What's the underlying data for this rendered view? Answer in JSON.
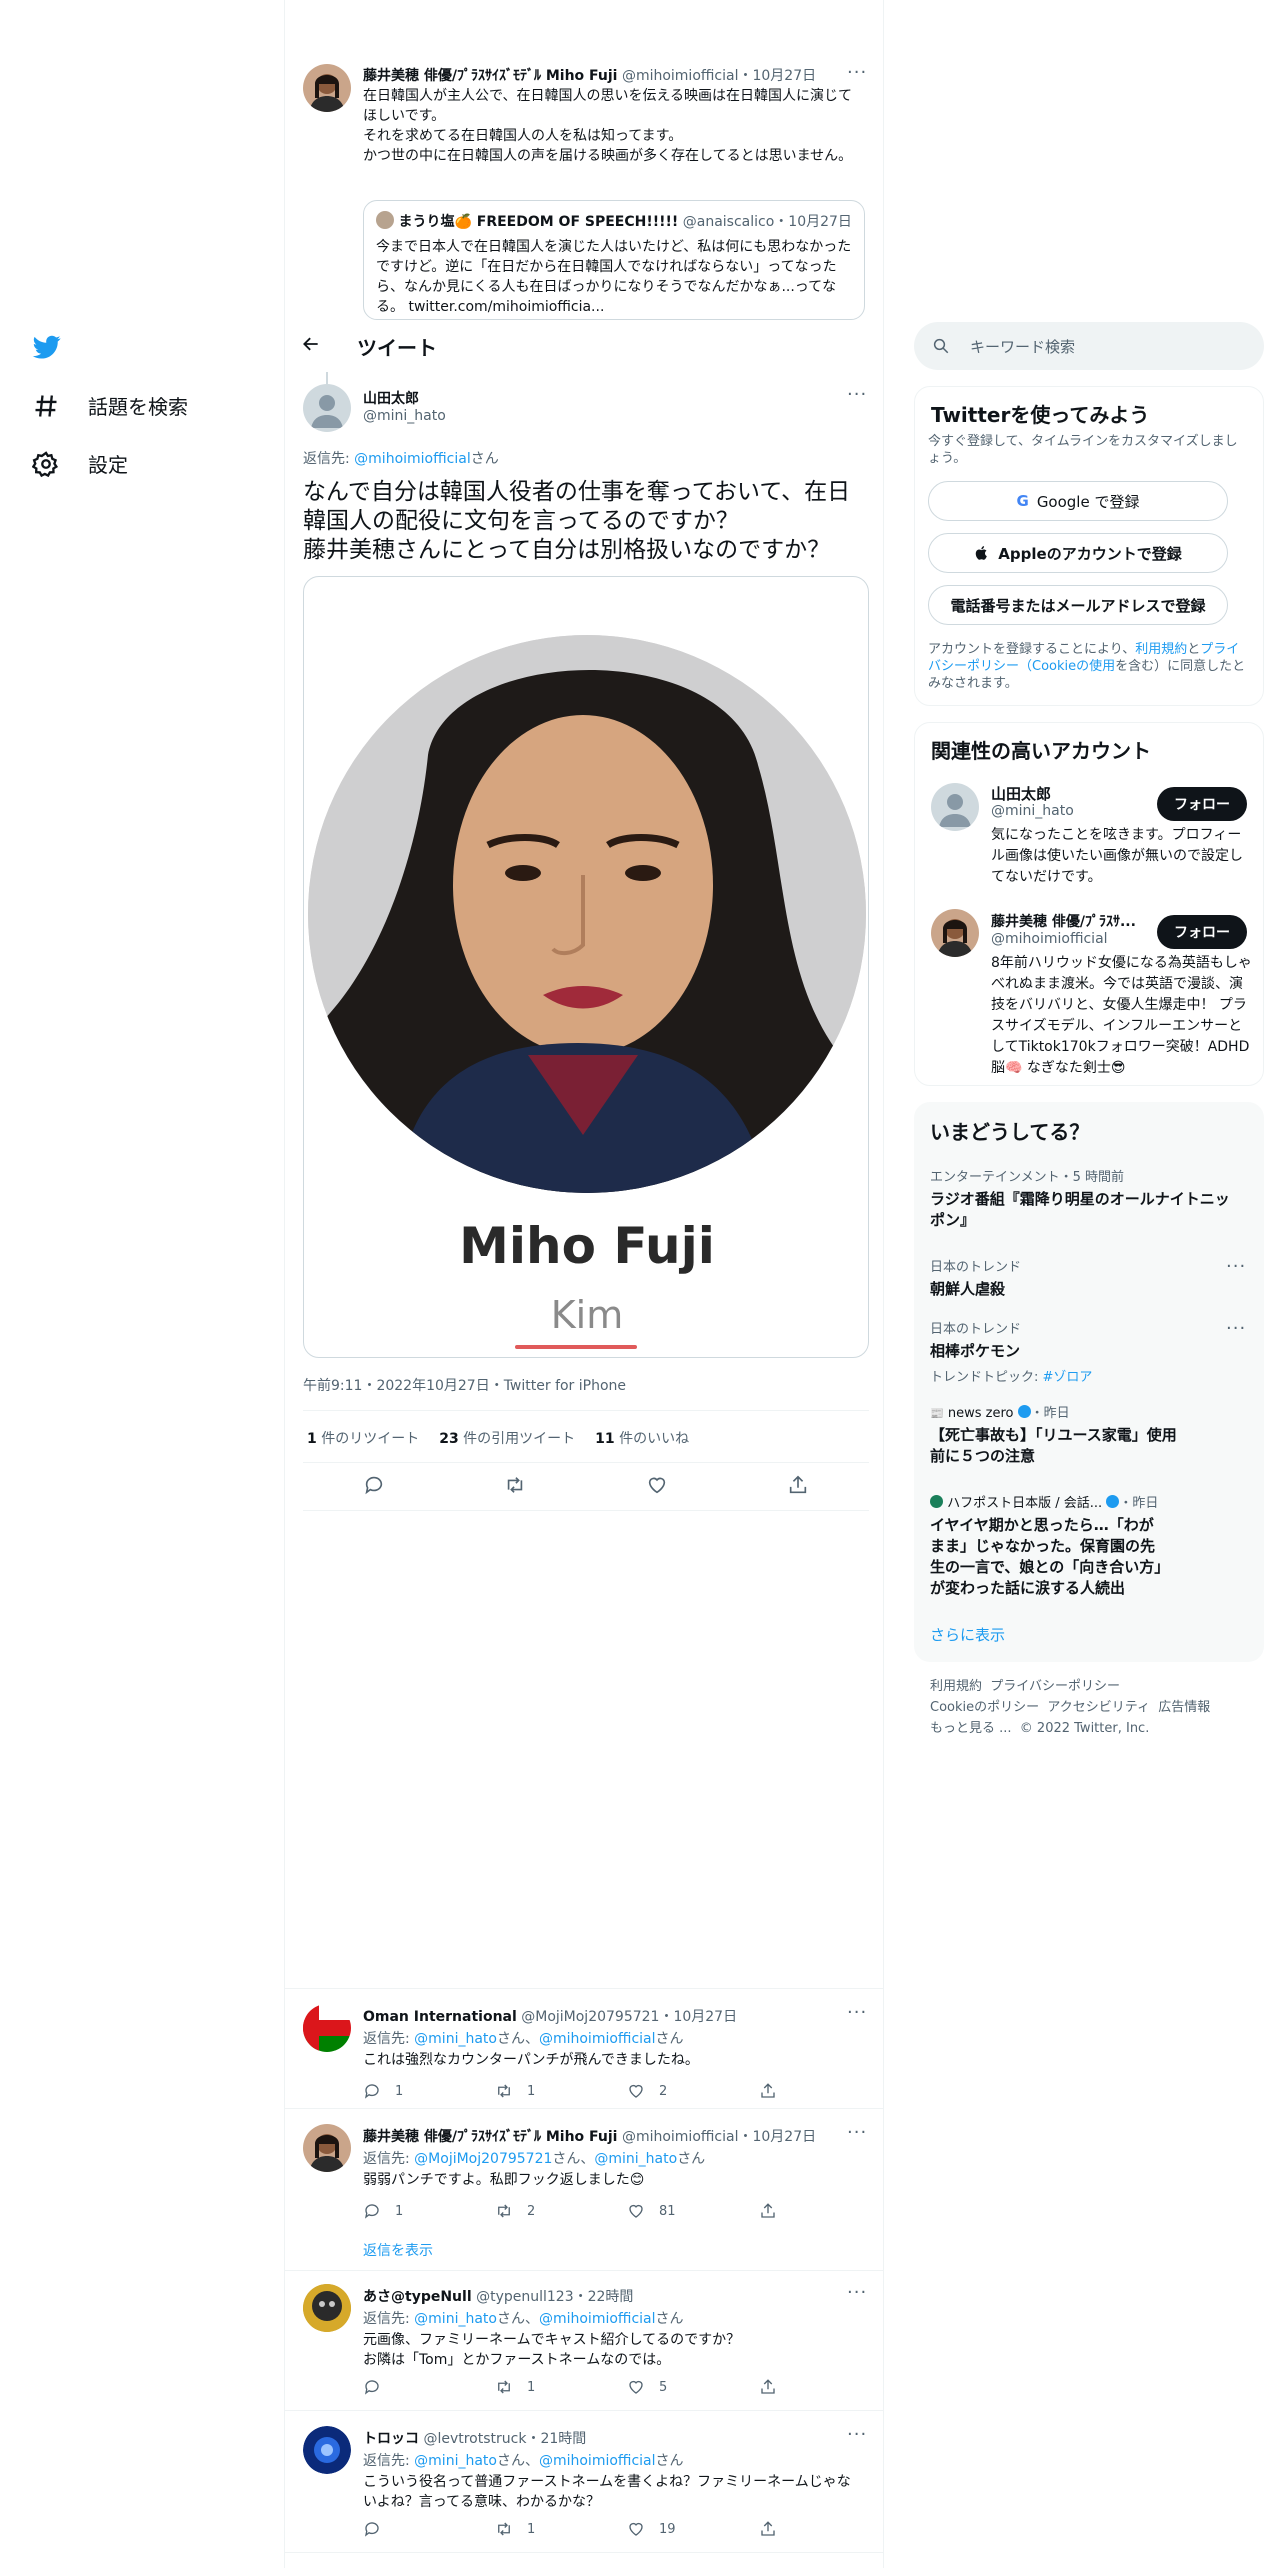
{
  "nav": {
    "items": [
      {
        "label": "話題を検索",
        "icon": "hashtag-icon"
      },
      {
        "label": "設定",
        "icon": "gear-icon"
      }
    ]
  },
  "quoted_tweet": {
    "author_name": "藤井美穂 俳優/ﾌﾟﾗｽｻｲｽﾞﾓﾃﾞﾙ Miho Fuji",
    "handle": "@mihoimiofficial",
    "date": "10月27日",
    "text": "在日韓国人が主人公で、在日韓国人の思いを伝える映画は在日韓国人に演じてほしいです。\nそれを求めてる在日韓国人の人を私は知ってます。\nかつ世の中に在日韓国人の声を届ける映画が多く存在してるとは思いません。",
    "inner": {
      "author_name": "まうり塩🍊 FREEDOM OF SPEECH!!!!!",
      "handle": "@anaiscalico",
      "date": "10月27日",
      "text": "今まで日本人で在日韓国人を演じた人はいたけど、私は何にも思わなかったですけど。逆に「在日だから在日韓国人でなければならない」ってなったら、なんか見にくる人も在日ばっかりになりそうでなんだかなぁ...ってなる。 twitter.com/mihoimiofficia..."
    }
  },
  "header": {
    "title": "ツイート"
  },
  "main_tweet": {
    "author_name": "山田太郎",
    "handle": "@mini_hato",
    "reply_prefix": "返信先: ",
    "reply_to": "@mihoimiofficial",
    "reply_suffix": "さん",
    "text": "なんで自分は韓国人役者の仕事を奪っておいて、在日韓国人の配役に文句を言ってるのですか？\n藤井美穂さんにとって自分は別格扱いなのですか？",
    "image_name": "Miho Fuji",
    "image_sub": "Kim",
    "meta": "午前9:11・2022年10月27日・Twitter for iPhone",
    "stats": [
      {
        "count": "1",
        "label": " 件のリツイート"
      },
      {
        "count": "23",
        "label": " 件の引用ツイート"
      },
      {
        "count": "11",
        "label": " 件のいいね"
      }
    ]
  },
  "replies": [
    {
      "author_name": "Oman International",
      "handle": "@MojiMoj20795721",
      "date": "10月27日",
      "reply_to_a": "@mini_hato",
      "reply_to_b": "@mihoimiofficial",
      "text": "これは強烈なカウンターパンチが飛んできましたね。",
      "replies": "1",
      "retweets": "1",
      "likes": "2"
    },
    {
      "author_name": "藤井美穂 俳優/ﾌﾟﾗｽｻｲｽﾞﾓﾃﾞﾙ Miho Fuji",
      "handle": "@mihoimiofficial",
      "date": "10月27日",
      "reply_to_a": "@MojiMoj20795721",
      "reply_to_b": "@mini_hato",
      "text": "弱弱パンチですよ。私即フック返しました😊",
      "replies": "1",
      "retweets": "2",
      "likes": "81"
    },
    {
      "author_name": "あさ@typeNull",
      "handle": "@typenull123",
      "date": "22時間",
      "reply_to_a": "@mini_hato",
      "reply_to_b": "@mihoimiofficial",
      "text": "元画像、ファミリーネームでキャスト紹介してるのですか？\nお隣は「Tom」とかファーストネームなのでは。",
      "replies": "",
      "retweets": "1",
      "likes": "5"
    },
    {
      "author_name": "トロッコ",
      "handle": "@levtrotstruck",
      "date": "21時間",
      "reply_to_a": "@mini_hato",
      "reply_to_b": "@mihoimiofficial",
      "text": "こういう役名って普通ファーストネームを書くよね？ファミリーネームじゃないよね？言ってる意味、わかるかな？",
      "replies": "",
      "retweets": "1",
      "likes": "19"
    }
  ],
  "reply_common": {
    "prefix": "返信先: ",
    "san": "さん、",
    "san_end": "さん",
    "show_replies": "返信を表示"
  },
  "search": {
    "placeholder": "キーワード検索"
  },
  "signup": {
    "title": "Twitterを使ってみよう",
    "subtitle": "今すぐ登録して、タイムラインをカスタマイズしましょう。",
    "google": "Google で登録",
    "apple": "Appleのアカウントで登録",
    "phone": "電話番号またはメールアドレスで登録",
    "legal_a": "アカウントを登録することにより、",
    "legal_terms": "利用規約",
    "legal_and": "と",
    "legal_privacy": "プライバシーポリシー",
    "legal_open": "（",
    "legal_cookie": "Cookieの使用",
    "legal_close": "を含む）に同意したとみなされます。"
  },
  "related": {
    "title": "関連性の高いアカウント",
    "accounts": [
      {
        "name": "山田太郎",
        "handle": "@mini_hato",
        "bio": "気になったことを呟きます。プロフィール画像は使いたい画像が無いので設定してないだけです。",
        "follow": "フォロー"
      },
      {
        "name": "藤井美穂 俳優/ﾌﾟﾗｽｻ...",
        "handle": "@mihoimiofficial",
        "bio": "8年前ハリウッド女優になる為英語もしゃべれぬまま渡米。今では英語で漫談、演技をバリバリと、女優人生爆走中！ プラスサイズモデル、インフルーエンサーとしてTiktok170kフォロワー突破！ADHD脳🧠 なぎなた剣士😎",
        "follow": "フォロー"
      }
    ]
  },
  "trends": {
    "title": "いまどうしてる？",
    "items": [
      {
        "meta": "エンターテインメント・5 時間前",
        "title": "ラジオ番組『霜降り明星のオールナイトニッポン』",
        "extra": ""
      },
      {
        "meta": "日本のトレンド",
        "title": "朝鮮人虐殺",
        "extra": ""
      },
      {
        "meta": "日本のトレンド",
        "title": "相棒ポケモン",
        "extra_label": "トレンドトピック: ",
        "extra": "#ゾロア"
      },
      {
        "meta_source": "news zero",
        "meta": "・昨日",
        "title": "【死亡事故も】「リユース家電」使用前に５つの注意",
        "extra": ""
      },
      {
        "meta_source": "ハフポスト日本版 / 会話...",
        "meta": "・昨日",
        "title": "イヤイヤ期かと思ったら…「わがまま」じゃなかった。保育園の先生の一言で、娘との「向き合い方」が変わった話に涙する人続出",
        "extra": ""
      }
    ],
    "more": "さらに表示"
  },
  "footer": {
    "links": [
      "利用規約",
      "プライバシーポリシー",
      "Cookieのポリシー",
      "アクセシビリティ",
      "広告情報",
      "もっと見る ..."
    ],
    "copyright": "© 2022 Twitter, Inc."
  },
  "colors": {
    "accent": "#1d9bf0",
    "text": "#0f1419",
    "secondary": "#536471",
    "border": "#eff3f4",
    "button_dark": "#0f1419"
  }
}
